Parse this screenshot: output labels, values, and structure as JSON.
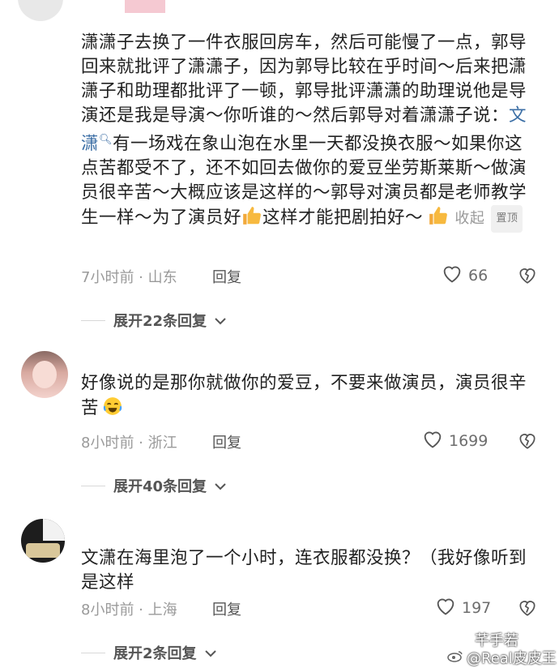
{
  "comments": [
    {
      "text_before": "潇潇子去换了一件衣服回房车，然后可能慢了一点，郭导回来就批评了潇潇子，因为郭导比较在乎时间～后来把潇潇子和助理都批评了一顿，郭导批评潇潇的助理说他是导演还是我是导演～你听谁的～然后郭导对着潇潇子说：",
      "mention": "文潇",
      "text_after": "有一场戏在象山泡在水里一天都没换衣服～如果你这点苦都受不了，还不如回去做你的爱豆坐劳斯莱斯～做演员很辛苦～大概应该是这样的～郭导对演员都是老师教学生一样～为了演员好",
      "text_end": "这样才能把剧拍好～",
      "collapse_label": "收起",
      "pinned_label": "置顶",
      "time_location": "7小时前 · 山东",
      "reply_label": "回复",
      "likes": "66",
      "expand_label": "展开22条回复"
    },
    {
      "text": "好像说的是那你就做你的爱豆，不要来做演员，演员很辛苦",
      "time_location": "8小时前 · 浙江",
      "reply_label": "回复",
      "likes": "1699",
      "expand_label": "展开40条回复"
    },
    {
      "text": "文潇在海里泡了一个小时，连衣服都没换？（我好像听到是这样",
      "time_location": "8小时前 · 上海",
      "reply_label": "回复",
      "likes": "197",
      "expand_label": "展开2条回复"
    }
  ],
  "watermark": {
    "top": "芊手若",
    "bottom": "@Real皮皮王"
  },
  "colors": {
    "mention": "#3b6ea5",
    "meta": "#9a9a9a"
  }
}
